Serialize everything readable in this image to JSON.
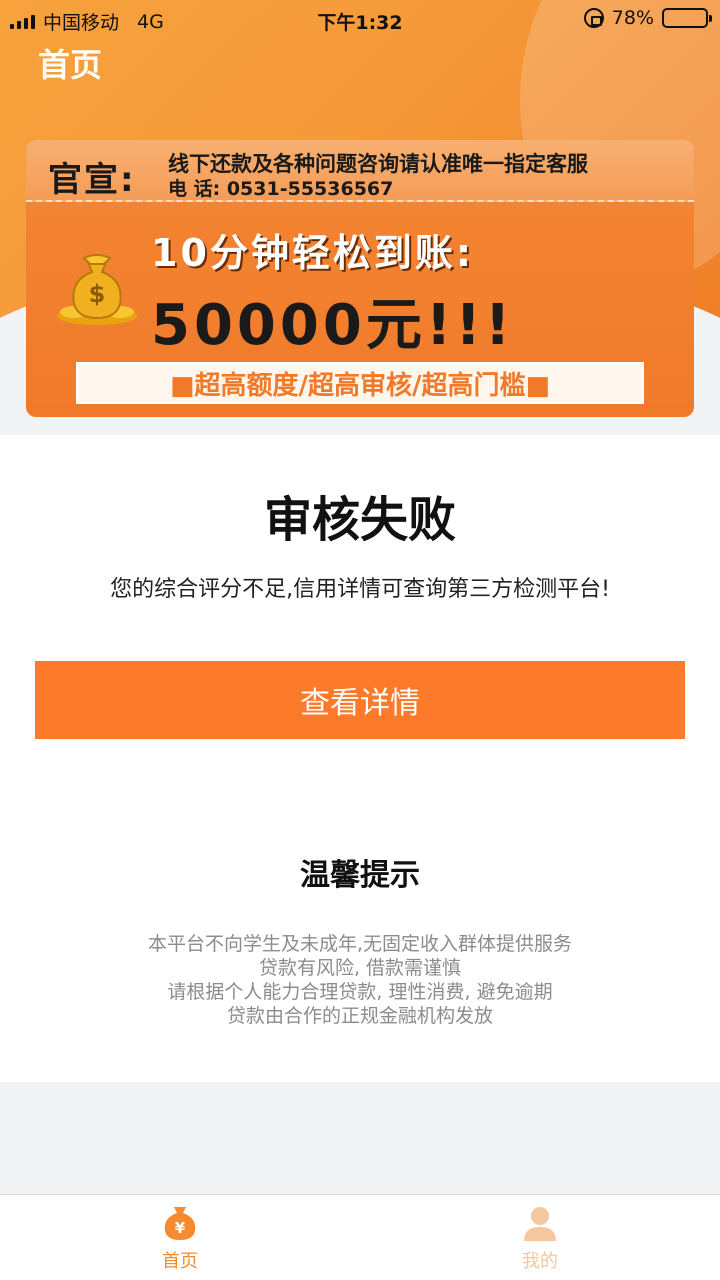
{
  "status_bar": {
    "carrier": "中国移动",
    "network": "4G",
    "time": "下午1:32",
    "battery": "78%"
  },
  "header": {
    "title": "首页"
  },
  "banner": {
    "official": "官宣:",
    "notice_line1": "线下还款及各种问题咨询请认准唯一指定客服",
    "notice_line2": "电 话: 0531-55536567",
    "headline": "10分钟轻松到账:",
    "amount": "50000元!!!",
    "tagline": "■超高额度/超高审核/超高门槛■"
  },
  "result": {
    "title": "审核失败",
    "description": "您的综合评分不足,信用详情可查询第三方检测平台!",
    "button_label": "查看详情"
  },
  "tips": {
    "title": "温馨提示",
    "lines": [
      "本平台不向学生及未成年,无固定收入群体提供服务",
      "贷款有风险, 借款需谨慎",
      "请根据个人能力合理贷款, 理性消费, 避免逾期",
      "贷款由合作的正规金融机构发放"
    ]
  },
  "tabbar": {
    "home_label": "首页",
    "me_label": "我的"
  },
  "colors": {
    "accent": "#fd7a2a",
    "tab_active": "#f58a2e",
    "tab_inactive": "#f5c79e"
  },
  "icons": {
    "home": "money-bag-yen-icon",
    "me": "person-icon"
  }
}
